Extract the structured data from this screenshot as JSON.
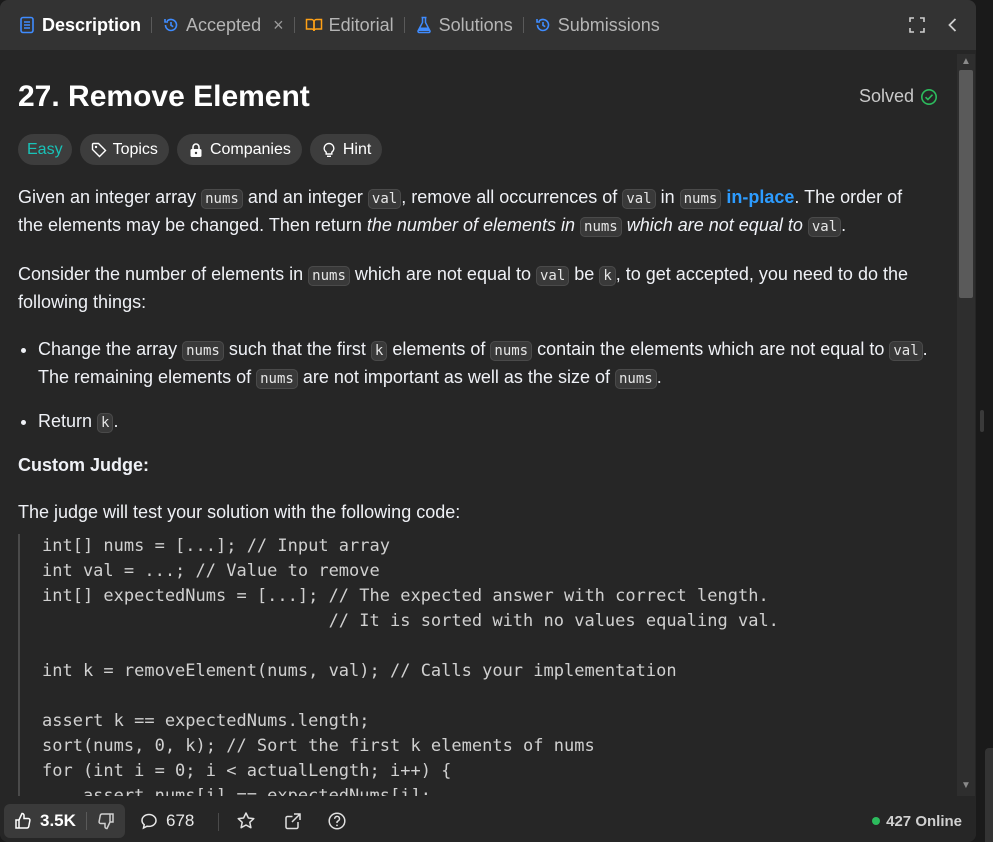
{
  "tabs": [
    {
      "label": "Description",
      "icon": "document-icon",
      "active": true
    },
    {
      "label": "Accepted",
      "icon": "history-icon",
      "closable": true
    },
    {
      "label": "Editorial",
      "icon": "book-icon"
    },
    {
      "label": "Solutions",
      "icon": "flask-icon"
    },
    {
      "label": "Submissions",
      "icon": "history-icon"
    }
  ],
  "tab_close": "×",
  "problem": {
    "title": "27. Remove Element",
    "status": "Solved",
    "difficulty": "Easy",
    "chips": [
      "Topics",
      "Companies",
      "Hint"
    ]
  },
  "desc": {
    "p1": {
      "a": "Given an integer array ",
      "c1": "nums",
      "b": " and an integer ",
      "c2": "val",
      "c": ", remove all occurrences of ",
      "c3": "val",
      "d": " in ",
      "c4": "nums",
      "e": " ",
      "link": "in-place",
      "f": ". The order of the elements may be changed. Then return ",
      "em1": "the number of elements in ",
      "c5": "nums",
      "em2": " which are not equal to ",
      "c6": "val",
      "g": "."
    },
    "p2": {
      "a": "Consider the number of elements in ",
      "c1": "nums",
      "b": " which are not equal to ",
      "c2": "val",
      "c": " be ",
      "c3": "k",
      "d": ", to get accepted, you need to do the following things:"
    },
    "b1": {
      "a": "Change the array ",
      "c1": "nums",
      "b": " such that the first ",
      "c2": "k",
      "c": " elements of ",
      "c3": "nums",
      "d": " contain the elements which are not equal to ",
      "c4": "val",
      "e": ". The remaining elements of ",
      "c5": "nums",
      "f": " are not important as well as the size of ",
      "c6": "nums",
      "g": "."
    },
    "b2": {
      "a": "Return ",
      "c1": "k",
      "b": "."
    },
    "judge_heading": "Custom Judge:",
    "judge_text": "The judge will test your solution with the following code:"
  },
  "code": "int[] nums = [...]; // Input array\nint val = ...; // Value to remove\nint[] expectedNums = [...]; // The expected answer with correct length.\n                            // It is sorted with no values equaling val.\n\nint k = removeElement(nums, val); // Calls your implementation\n\nassert k == expectedNums.length;\nsort(nums, 0, k); // Sort the first k elements of nums\nfor (int i = 0; i < actualLength; i++) {\n    assert nums[i] == expectedNums[i];",
  "footer": {
    "likes": "3.5K",
    "comments": "678",
    "online": "427 Online"
  },
  "colors": {
    "easy": "#19c2b7",
    "solved": "#2cbb5d",
    "link": "#2d9cff",
    "online_dot": "#2cbb5d"
  }
}
